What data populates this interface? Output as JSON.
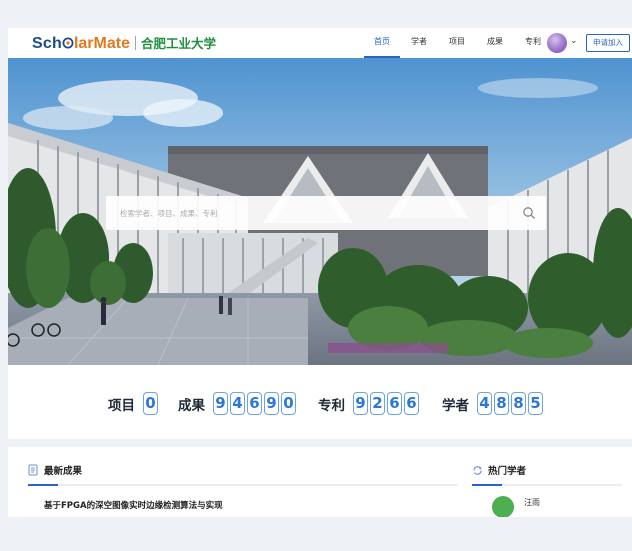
{
  "header": {
    "logo_part1": "Sch",
    "logo_part2": "larMate",
    "logo_school": "合肥工业大学",
    "nav": [
      "首页",
      "学者",
      "项目",
      "成果",
      "专利"
    ],
    "apply_label": "申请加入"
  },
  "search": {
    "placeholder": "检索学者、项目、成果、专利"
  },
  "stats": [
    {
      "label": "项目",
      "digits": [
        "0"
      ]
    },
    {
      "label": "成果",
      "digits": [
        "9",
        "4",
        "6",
        "9",
        "0"
      ]
    },
    {
      "label": "专利",
      "digits": [
        "9",
        "2",
        "6",
        "6"
      ]
    },
    {
      "label": "学者",
      "digits": [
        "4",
        "8",
        "8",
        "5"
      ]
    }
  ],
  "latest_results": {
    "title": "最新成果",
    "items": [
      "基于FPGA的深空图像实时边缘检测算法与实现"
    ]
  },
  "hot_scholars": {
    "title": "热门学者",
    "items": [
      "汪雨"
    ]
  },
  "colors": {
    "brand_blue": "#1c4b8c",
    "brand_orange": "#e07a1f",
    "school_green": "#1e8f3c",
    "accent": "#2b63c4",
    "digit_border": "#6aa3e8"
  },
  "icons": {
    "logo_o": "circle-o-icon",
    "search": "search-icon",
    "chevron": "chevron-down-icon",
    "latest_results": "document-icon",
    "hot_scholars": "refresh-icon"
  }
}
